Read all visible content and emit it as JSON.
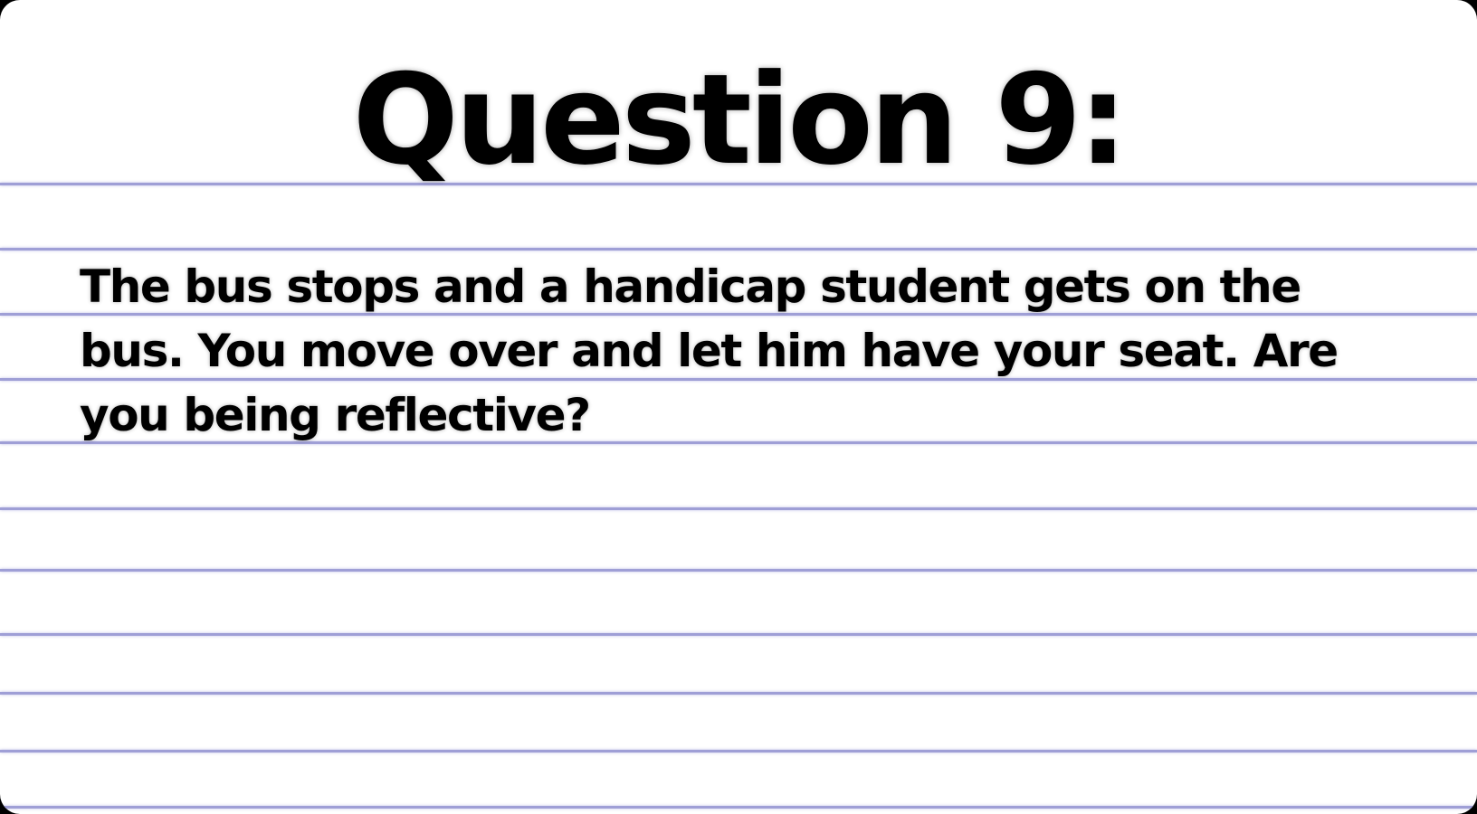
{
  "slide": {
    "title": "Question 9:",
    "body": "The bus stops and a handicap student gets on the bus. You move over and let him have your seat. Are you being reflective?"
  },
  "colors": {
    "background": "#ffffff",
    "rule_line": "#9f9fd6",
    "text": "#000000"
  }
}
